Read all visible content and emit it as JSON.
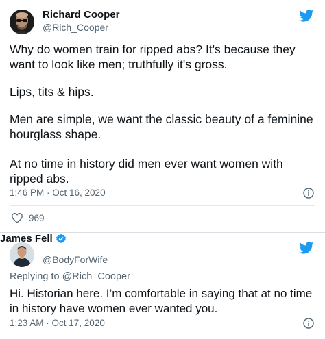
{
  "colors": {
    "twitter_blue": "#1d9bf0",
    "verified_blue": "#1d9bf0",
    "muted": "#536471",
    "text": "#0f1419"
  },
  "tweet1": {
    "author_name": "Richard Cooper",
    "author_handle": "@Rich_Cooper",
    "text_lines": [
      "Why do women train for ripped abs?  It's because they want to look like men; truthfully it's gross.",
      "Lips, tits & hips.",
      "Men are simple, we want the classic beauty of a feminine hourglass shape.",
      "At no time in history did men ever want women with ripped abs."
    ],
    "timestamp": "1:46 PM · Oct 16, 2020",
    "likes": "969",
    "icons": {
      "bird": "twitter-bird-icon",
      "info": "info-icon",
      "like": "heart-icon"
    }
  },
  "tweet2": {
    "author_name": "James Fell",
    "author_handle": "@BodyForWife",
    "replying_to": "Replying to @Rich_Cooper",
    "text": "Hi. Historian here. I’m comfortable in saying that at no time in history have women ever wanted you.",
    "timestamp": "1:23 AM · Oct 17, 2020",
    "icons": {
      "bird": "twitter-bird-icon",
      "info": "info-icon",
      "verified": "verified-badge-icon"
    }
  }
}
